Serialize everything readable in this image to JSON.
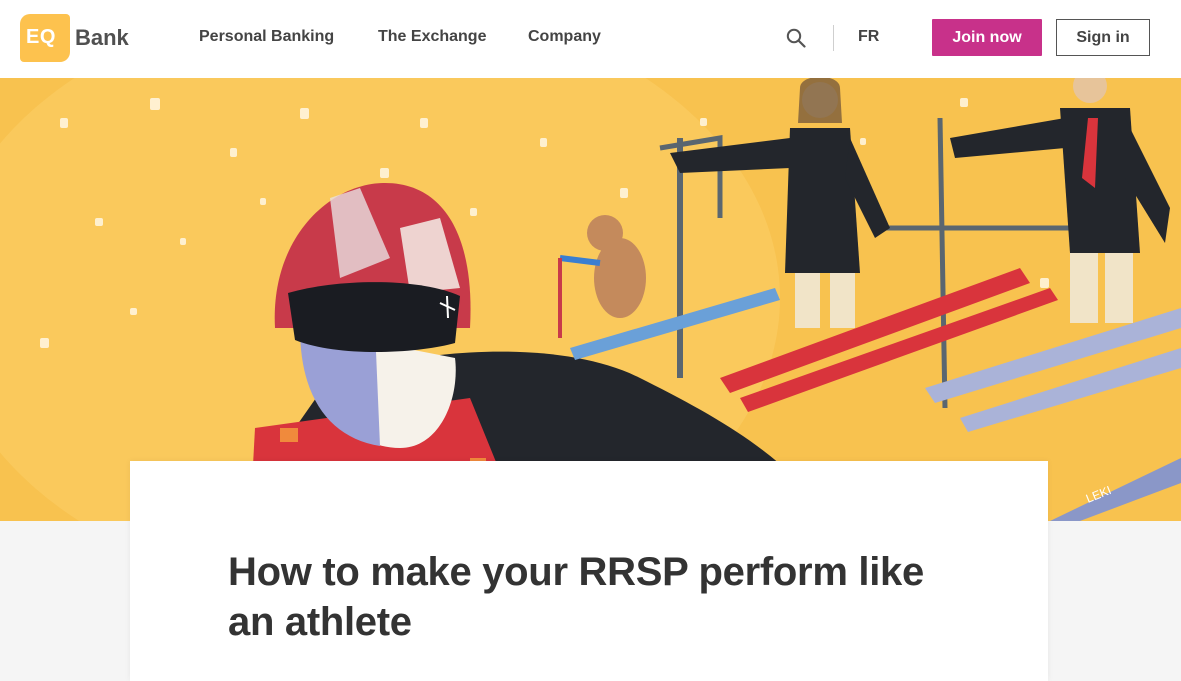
{
  "brand": {
    "badge_text": "EQ",
    "name": "Bank",
    "badge_color": "#fdc24e"
  },
  "nav": {
    "items": [
      {
        "label": "Personal Banking"
      },
      {
        "label": "The Exchange"
      },
      {
        "label": "Company"
      }
    ],
    "search_icon": "search-icon",
    "language_toggle": "FR",
    "join_label": "Join now",
    "signin_label": "Sign in"
  },
  "hero": {
    "image": "illustrated ski scene",
    "background_color": "#f8c24f",
    "ski_text": "LEKI"
  },
  "article": {
    "title": "How to make your RRSP perform like an athlete"
  },
  "colors": {
    "accent": "#c8318a",
    "hero_yellow": "#f8c24f",
    "text": "#333333"
  }
}
